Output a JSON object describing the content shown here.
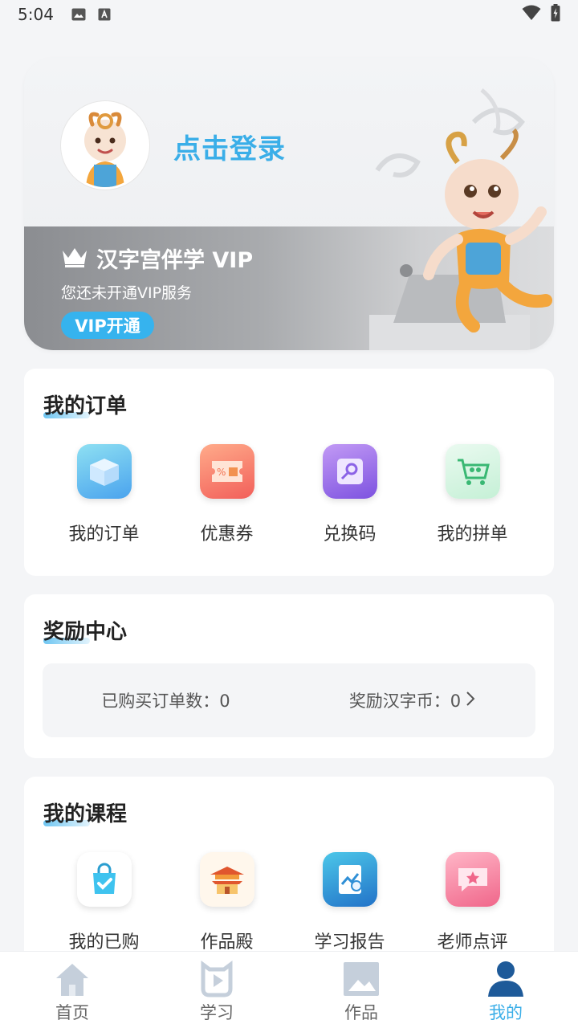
{
  "status_bar": {
    "time": "5:04"
  },
  "profile": {
    "login_label": "点击登录",
    "vip_title": "汉字宫伴学 VIP",
    "vip_subtitle": "您还未开通VIP服务",
    "vip_button": "VIP开通"
  },
  "orders": {
    "title": "我的订单",
    "items": [
      {
        "label": "我的订单",
        "icon": "box-icon",
        "color": "#5ab5f0"
      },
      {
        "label": "优惠券",
        "icon": "coupon-icon",
        "color": "#f4705e"
      },
      {
        "label": "兑换码",
        "icon": "redeem-code-icon",
        "color": "#8f63e8"
      },
      {
        "label": "我的拼单",
        "icon": "group-cart-icon",
        "color": "#4fcf88"
      }
    ]
  },
  "rewards": {
    "title": "奖励中心",
    "orders_count": "已购买订单数：0",
    "coins": "奖励汉字币：0"
  },
  "courses": {
    "title": "我的课程",
    "items": [
      {
        "label": "我的已购",
        "icon": "shopping-bag-icon",
        "color": "#3fc3ef"
      },
      {
        "label": "作品殿",
        "icon": "palace-icon",
        "color": "#f29a3a"
      },
      {
        "label": "学习报告",
        "icon": "report-icon",
        "color": "#2f8fd6"
      },
      {
        "label": "老师点评",
        "icon": "comment-icon",
        "color": "#f26a8a"
      }
    ]
  },
  "tabs": [
    {
      "label": "首页",
      "icon": "home-icon",
      "active": false
    },
    {
      "label": "学习",
      "icon": "play-icon",
      "active": false
    },
    {
      "label": "作品",
      "icon": "image-icon",
      "active": false
    },
    {
      "label": "我的",
      "icon": "person-icon",
      "active": true
    }
  ],
  "colors": {
    "accent": "#3aaee8",
    "vip_button": "#36b3ee",
    "active_tab": "#1e5a99"
  }
}
